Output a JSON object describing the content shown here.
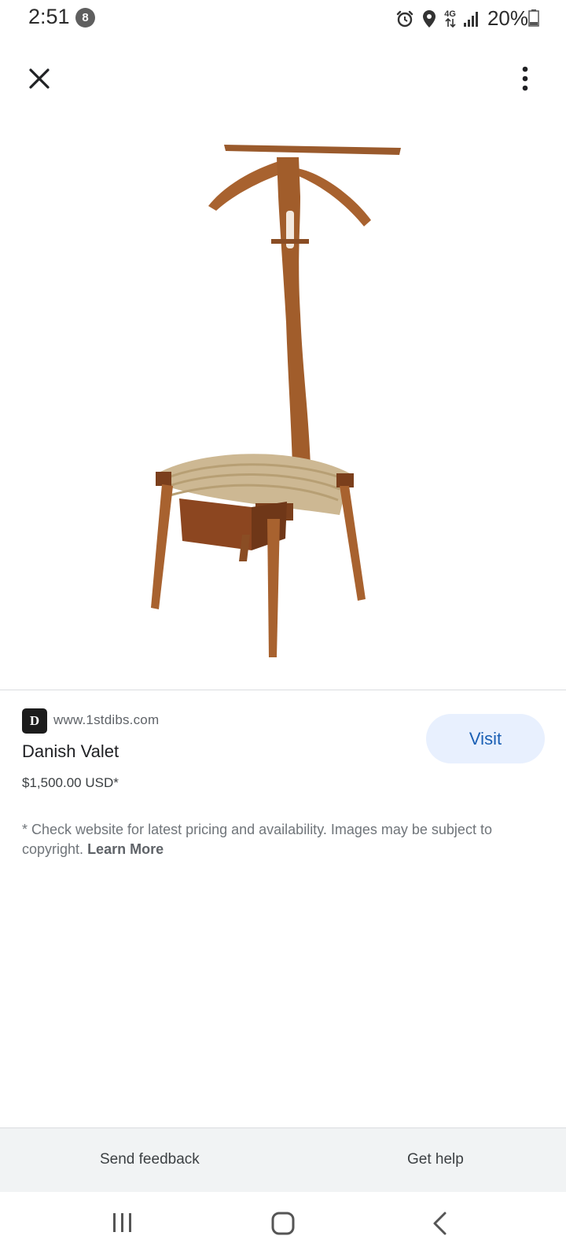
{
  "status_bar": {
    "time": "2:51",
    "notification_count": "8",
    "network_label": "4G",
    "battery_percent": "20%"
  },
  "toolbar": {
    "close_icon": "close-icon",
    "more_icon": "more-vert-icon"
  },
  "product": {
    "image_description_icon": "danish-valet-chair-image",
    "logo_text": "D",
    "site": "www.1stdibs.com",
    "title": "Danish Valet",
    "price": "$1,500.00 USD*",
    "visit_label": "Visit",
    "disclaimer": "* Check website for latest pricing and availability. Images may be subject to copyright.",
    "learn_more": "Learn More"
  },
  "footer": {
    "send_feedback": "Send feedback",
    "get_help": "Get help"
  },
  "colors": {
    "accent": "#1a5fb4",
    "visit_bg": "#e8f0fe",
    "footer_bg": "#f1f3f4"
  }
}
